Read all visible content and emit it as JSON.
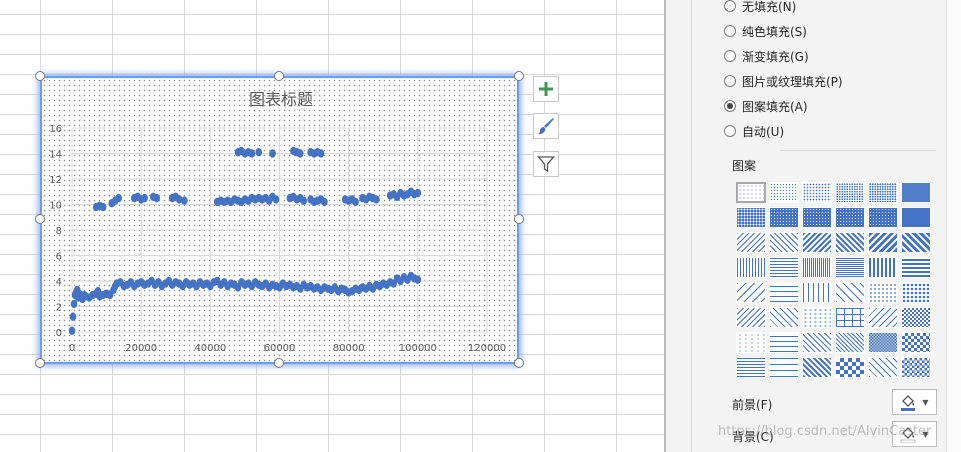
{
  "chart": {
    "title": "图表标题",
    "series_color": "#4472c4"
  },
  "chart_data": {
    "type": "scatter",
    "title": "图表标题",
    "xlim": [
      0,
      120000
    ],
    "ylim": [
      0,
      16
    ],
    "xticks": [
      0,
      20000,
      40000,
      60000,
      80000,
      100000,
      120000
    ],
    "yticks": [
      0,
      2,
      4,
      6,
      8,
      10,
      12,
      14,
      16
    ],
    "grid": true,
    "legend": "none",
    "series": [
      {
        "color": "#4472c4",
        "points": [
          [
            0,
            0.1
          ],
          [
            300,
            1.2
          ],
          [
            600,
            2.2
          ],
          [
            900,
            2.9
          ],
          [
            1200,
            3.1
          ],
          [
            1500,
            3.3
          ],
          [
            1800,
            2.7
          ],
          [
            2100,
            3.0
          ],
          [
            2500,
            2.8
          ],
          [
            3000,
            2.6
          ],
          [
            3500,
            2.9
          ],
          [
            4000,
            2.8
          ],
          [
            5000,
            2.7
          ],
          [
            6000,
            2.9
          ],
          [
            7000,
            3.0
          ],
          [
            7500,
            3.2
          ],
          [
            8000,
            2.8
          ],
          [
            9000,
            2.9
          ],
          [
            10000,
            3.0
          ],
          [
            11000,
            2.9
          ],
          [
            12000,
            3.3
          ],
          [
            12500,
            3.6
          ],
          [
            13000,
            3.8
          ],
          [
            14000,
            3.9
          ],
          [
            15000,
            3.6
          ],
          [
            16000,
            3.7
          ],
          [
            17000,
            3.9
          ],
          [
            18000,
            3.6
          ],
          [
            19000,
            3.8
          ],
          [
            20000,
            3.9
          ],
          [
            21000,
            3.7
          ],
          [
            22000,
            3.8
          ],
          [
            23000,
            4.0
          ],
          [
            24000,
            3.7
          ],
          [
            25000,
            3.9
          ],
          [
            26000,
            3.6
          ],
          [
            27000,
            3.8
          ],
          [
            28000,
            4.0
          ],
          [
            29000,
            3.7
          ],
          [
            30000,
            3.9
          ],
          [
            31000,
            3.8
          ],
          [
            32000,
            3.6
          ],
          [
            33000,
            3.9
          ],
          [
            34000,
            3.7
          ],
          [
            35000,
            3.8
          ],
          [
            36000,
            3.6
          ],
          [
            37000,
            3.9
          ],
          [
            38000,
            3.7
          ],
          [
            39000,
            3.8
          ],
          [
            40000,
            3.6
          ],
          [
            41000,
            3.9
          ],
          [
            42000,
            4.0
          ],
          [
            43000,
            3.7
          ],
          [
            44000,
            3.9
          ],
          [
            45000,
            3.6
          ],
          [
            46000,
            3.8
          ],
          [
            47000,
            3.7
          ],
          [
            48000,
            3.5
          ],
          [
            49000,
            3.9
          ],
          [
            50000,
            3.7
          ],
          [
            51000,
            3.8
          ],
          [
            52000,
            3.6
          ],
          [
            53000,
            3.9
          ],
          [
            54000,
            3.7
          ],
          [
            55000,
            3.6
          ],
          [
            56000,
            3.8
          ],
          [
            57000,
            3.5
          ],
          [
            58000,
            3.7
          ],
          [
            59000,
            3.6
          ],
          [
            60000,
            3.5
          ],
          [
            61000,
            3.8
          ],
          [
            62000,
            3.6
          ],
          [
            63000,
            3.7
          ],
          [
            64000,
            3.5
          ],
          [
            65000,
            3.6
          ],
          [
            66000,
            3.4
          ],
          [
            67000,
            3.7
          ],
          [
            68000,
            3.5
          ],
          [
            69000,
            3.6
          ],
          [
            70000,
            3.4
          ],
          [
            71000,
            3.5
          ],
          [
            72000,
            3.3
          ],
          [
            73000,
            3.5
          ],
          [
            74000,
            3.4
          ],
          [
            75000,
            3.3
          ],
          [
            76000,
            3.5
          ],
          [
            77000,
            3.2
          ],
          [
            78000,
            3.4
          ],
          [
            79000,
            3.3
          ],
          [
            80000,
            3.1
          ],
          [
            81000,
            3.2
          ],
          [
            82000,
            3.4
          ],
          [
            83000,
            3.3
          ],
          [
            84000,
            3.5
          ],
          [
            85000,
            3.4
          ],
          [
            86000,
            3.6
          ],
          [
            87000,
            3.4
          ],
          [
            88000,
            3.7
          ],
          [
            89000,
            3.6
          ],
          [
            90000,
            3.8
          ],
          [
            91000,
            3.7
          ],
          [
            92000,
            3.9
          ],
          [
            93000,
            3.8
          ],
          [
            94000,
            4.2
          ],
          [
            95000,
            4.0
          ],
          [
            96000,
            4.3
          ],
          [
            97000,
            4.1
          ],
          [
            98000,
            4.4
          ],
          [
            99000,
            4.2
          ],
          [
            100000,
            4.1
          ],
          [
            7000,
            9.8
          ],
          [
            8000,
            9.9
          ],
          [
            9000,
            9.8
          ],
          [
            11500,
            10.1
          ],
          [
            12500,
            10.3
          ],
          [
            13500,
            10.5
          ],
          [
            18000,
            10.5
          ],
          [
            19000,
            10.6
          ],
          [
            20000,
            10.4
          ],
          [
            21000,
            10.5
          ],
          [
            23500,
            10.6
          ],
          [
            24500,
            10.5
          ],
          [
            29000,
            10.5
          ],
          [
            30000,
            10.6
          ],
          [
            31000,
            10.4
          ],
          [
            32500,
            10.3
          ],
          [
            42000,
            10.2
          ],
          [
            43000,
            10.3
          ],
          [
            44000,
            10.2
          ],
          [
            45000,
            10.3
          ],
          [
            46000,
            10.2
          ],
          [
            47000,
            10.4
          ],
          [
            48000,
            10.3
          ],
          [
            49000,
            10.2
          ],
          [
            50000,
            10.4
          ],
          [
            51000,
            10.3
          ],
          [
            52000,
            10.5
          ],
          [
            53000,
            10.4
          ],
          [
            54000,
            10.5
          ],
          [
            55000,
            10.4
          ],
          [
            56000,
            10.5
          ],
          [
            57000,
            10.3
          ],
          [
            58000,
            10.6
          ],
          [
            59000,
            10.4
          ],
          [
            63000,
            10.5
          ],
          [
            64000,
            10.6
          ],
          [
            65000,
            10.4
          ],
          [
            66000,
            10.5
          ],
          [
            67000,
            10.3
          ],
          [
            69000,
            10.4
          ],
          [
            70000,
            10.2
          ],
          [
            71000,
            10.3
          ],
          [
            72000,
            10.4
          ],
          [
            73000,
            10.2
          ],
          [
            79000,
            10.4
          ],
          [
            80000,
            10.3
          ],
          [
            81000,
            10.4
          ],
          [
            82000,
            10.2
          ],
          [
            84000,
            10.5
          ],
          [
            85000,
            10.4
          ],
          [
            86000,
            10.6
          ],
          [
            87000,
            10.5
          ],
          [
            88000,
            10.4
          ],
          [
            92000,
            10.7
          ],
          [
            93000,
            10.8
          ],
          [
            94000,
            10.6
          ],
          [
            95000,
            10.9
          ],
          [
            96000,
            10.7
          ],
          [
            97000,
            10.8
          ],
          [
            98000,
            11.0
          ],
          [
            99000,
            10.8
          ],
          [
            100000,
            10.9
          ],
          [
            48000,
            14.1
          ],
          [
            49000,
            14.2
          ],
          [
            50000,
            14.0
          ],
          [
            51000,
            14.1
          ],
          [
            52000,
            14.0
          ],
          [
            54000,
            14.1
          ],
          [
            58000,
            14.0
          ],
          [
            64000,
            14.2
          ],
          [
            65000,
            14.1
          ],
          [
            66000,
            14.0
          ],
          [
            69000,
            14.1
          ],
          [
            70000,
            14.0
          ],
          [
            71000,
            14.1
          ],
          [
            72000,
            14.0
          ]
        ]
      }
    ]
  },
  "pane": {
    "fill_options": [
      {
        "label": "无填充(N)",
        "checked": false
      },
      {
        "label": "纯色填充(S)",
        "checked": false
      },
      {
        "label": "渐变填充(G)",
        "checked": false
      },
      {
        "label": "图片或纹理填充(P)",
        "checked": false
      },
      {
        "label": "图案填充(A)",
        "checked": true
      },
      {
        "label": "自动(U)",
        "checked": false
      }
    ],
    "pattern_heading": "图案",
    "pattern_color": "#4472c4",
    "foreground_label": "前景(F)",
    "background_label": "背景(C)"
  },
  "watermark": "https://blog.csdn.net/AlvinCaster",
  "icons": {
    "add": "plus-icon",
    "style": "brush-icon",
    "filter": "funnel-icon"
  }
}
